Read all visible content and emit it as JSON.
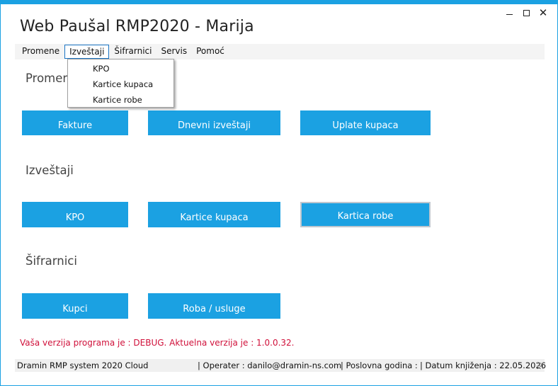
{
  "window": {
    "title": "Web Paušal RMP2020 - Marija",
    "controls": {
      "minimize": "minimize",
      "maximize": "maximize",
      "close": "✕"
    }
  },
  "menu": [
    {
      "label": "Promene"
    },
    {
      "label": "Izveštaji"
    },
    {
      "label": "Šifrarnici"
    },
    {
      "label": "Servis"
    },
    {
      "label": "Pomoć"
    }
  ],
  "dropdown": {
    "items": [
      {
        "label": "KPO"
      },
      {
        "label": "Kartice kupaca"
      },
      {
        "label": "Kartice robe"
      }
    ]
  },
  "sections": [
    {
      "title": "Promene",
      "tiles": [
        {
          "label": "Fakture"
        },
        {
          "label": "Dnevni izveštaji"
        },
        {
          "label": "Uplate kupaca"
        }
      ]
    },
    {
      "title": "Izveštaji",
      "tiles": [
        {
          "label": "KPO"
        },
        {
          "label": "Kartice kupaca"
        },
        {
          "label": "Kartica robe"
        }
      ]
    },
    {
      "title": "Šifrarnici",
      "tiles": [
        {
          "label": "Kupci"
        },
        {
          "label": "Roba / usluge"
        }
      ]
    }
  ],
  "version_message": "Vaša verzija programa je : DEBUG. Aktuelna verzija je : 1.0.0.32.",
  "statusbar": {
    "app": "Dramin RMP system 2020 Cloud",
    "operator": "|  Operater : danilo@dramin-ns.com",
    "year": "|  Poslovna godina :",
    "date": "|  Datum knjiženja : 22.05.2026"
  },
  "colors": {
    "accent": "#1ba1e2",
    "warning_text": "#d0103a",
    "menu_open_border": "#1a74c4"
  },
  "icons": {
    "minimize": "minimize-icon",
    "maximize": "maximize-icon",
    "close": "close-icon",
    "grip": "resize-grip-icon"
  }
}
